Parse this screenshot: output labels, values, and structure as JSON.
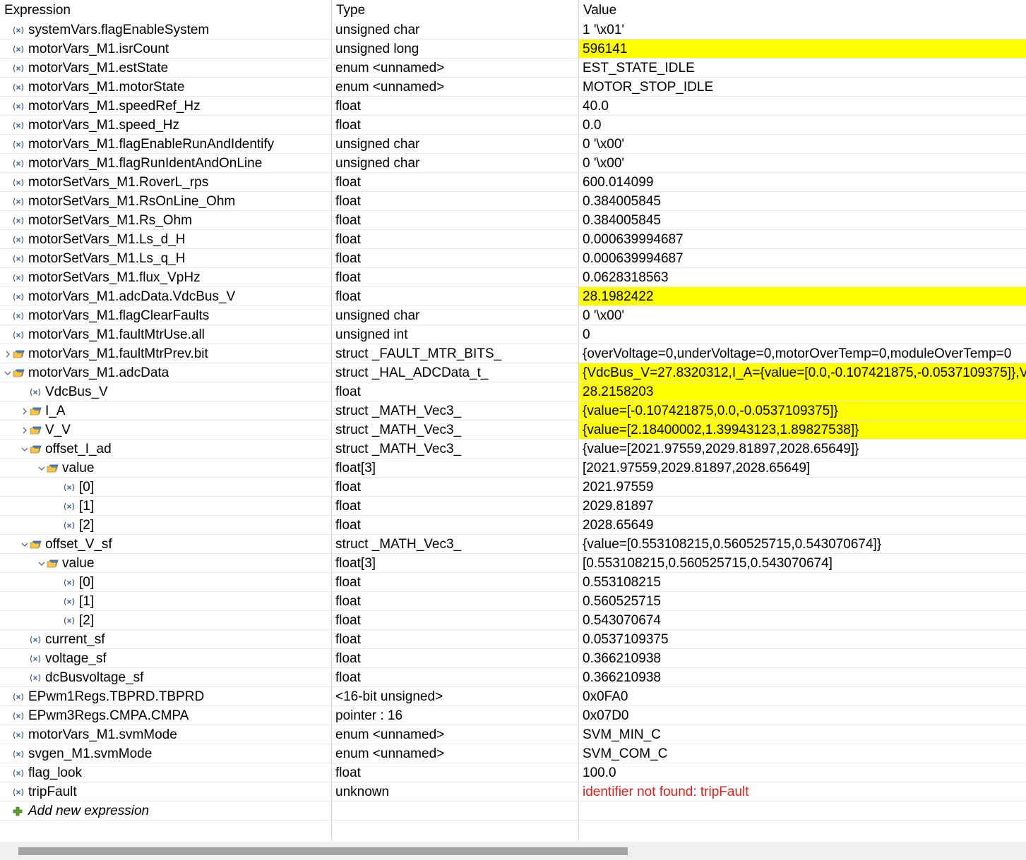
{
  "columns": {
    "expression": "Expression",
    "type": "Type",
    "value": "Value"
  },
  "rows": [
    {
      "indent": 1,
      "expander": "none",
      "icon": "variable",
      "expression": "systemVars.flagEnableSystem",
      "type": "unsigned char",
      "value": "1 '\\x01'",
      "highlight": false,
      "error": false
    },
    {
      "indent": 1,
      "expander": "none",
      "icon": "variable",
      "expression": "motorVars_M1.isrCount",
      "type": "unsigned long",
      "value": "596141",
      "highlight": true,
      "error": false
    },
    {
      "indent": 1,
      "expander": "none",
      "icon": "variable",
      "expression": "motorVars_M1.estState",
      "type": "enum <unnamed>",
      "value": "EST_STATE_IDLE",
      "highlight": false,
      "error": false
    },
    {
      "indent": 1,
      "expander": "none",
      "icon": "variable",
      "expression": "motorVars_M1.motorState",
      "type": "enum <unnamed>",
      "value": "MOTOR_STOP_IDLE",
      "highlight": false,
      "error": false
    },
    {
      "indent": 1,
      "expander": "none",
      "icon": "variable",
      "expression": "motorVars_M1.speedRef_Hz",
      "type": "float",
      "value": "40.0",
      "highlight": false,
      "error": false
    },
    {
      "indent": 1,
      "expander": "none",
      "icon": "variable",
      "expression": "motorVars_M1.speed_Hz",
      "type": "float",
      "value": "0.0",
      "highlight": false,
      "error": false
    },
    {
      "indent": 1,
      "expander": "none",
      "icon": "variable",
      "expression": "motorVars_M1.flagEnableRunAndIdentify",
      "type": "unsigned char",
      "value": "0 '\\x00'",
      "highlight": false,
      "error": false
    },
    {
      "indent": 1,
      "expander": "none",
      "icon": "variable",
      "expression": "motorVars_M1.flagRunIdentAndOnLine",
      "type": "unsigned char",
      "value": "0 '\\x00'",
      "highlight": false,
      "error": false
    },
    {
      "indent": 1,
      "expander": "none",
      "icon": "variable",
      "expression": "motorSetVars_M1.RoverL_rps",
      "type": "float",
      "value": "600.014099",
      "highlight": false,
      "error": false
    },
    {
      "indent": 1,
      "expander": "none",
      "icon": "variable",
      "expression": "motorSetVars_M1.RsOnLine_Ohm",
      "type": "float",
      "value": "0.384005845",
      "highlight": false,
      "error": false
    },
    {
      "indent": 1,
      "expander": "none",
      "icon": "variable",
      "expression": "motorSetVars_M1.Rs_Ohm",
      "type": "float",
      "value": "0.384005845",
      "highlight": false,
      "error": false
    },
    {
      "indent": 1,
      "expander": "none",
      "icon": "variable",
      "expression": "motorSetVars_M1.Ls_d_H",
      "type": "float",
      "value": "0.000639994687",
      "highlight": false,
      "error": false
    },
    {
      "indent": 1,
      "expander": "none",
      "icon": "variable",
      "expression": "motorSetVars_M1.Ls_q_H",
      "type": "float",
      "value": "0.000639994687",
      "highlight": false,
      "error": false
    },
    {
      "indent": 1,
      "expander": "none",
      "icon": "variable",
      "expression": "motorSetVars_M1.flux_VpHz",
      "type": "float",
      "value": "0.0628318563",
      "highlight": false,
      "error": false
    },
    {
      "indent": 1,
      "expander": "none",
      "icon": "variable",
      "expression": "motorVars_M1.adcData.VdcBus_V",
      "type": "float",
      "value": "28.1982422",
      "highlight": true,
      "error": false
    },
    {
      "indent": 1,
      "expander": "none",
      "icon": "variable",
      "expression": "motorVars_M1.flagClearFaults",
      "type": "unsigned char",
      "value": "0 '\\x00'",
      "highlight": false,
      "error": false
    },
    {
      "indent": 1,
      "expander": "none",
      "icon": "variable",
      "expression": "motorVars_M1.faultMtrUse.all",
      "type": "unsigned int",
      "value": "0",
      "highlight": false,
      "error": false
    },
    {
      "indent": 1,
      "expander": "collapsed",
      "icon": "struct",
      "expression": "motorVars_M1.faultMtrPrev.bit",
      "type": "struct _FAULT_MTR_BITS_",
      "value": "{overVoltage=0,underVoltage=0,motorOverTemp=0,moduleOverTemp=0",
      "highlight": false,
      "error": false
    },
    {
      "indent": 1,
      "expander": "expanded",
      "icon": "struct",
      "expression": "motorVars_M1.adcData",
      "type": "struct _HAL_ADCData_t_",
      "value": "{VdcBus_V=27.8320312,I_A={value=[0.0,-0.107421875,-0.0537109375]},V",
      "highlight": true,
      "error": false
    },
    {
      "indent": 2,
      "expander": "none",
      "icon": "variable",
      "expression": "VdcBus_V",
      "type": "float",
      "value": "28.2158203",
      "highlight": true,
      "error": false
    },
    {
      "indent": 2,
      "expander": "collapsed",
      "icon": "struct",
      "expression": "I_A",
      "type": "struct _MATH_Vec3_",
      "value": "{value=[-0.107421875,0.0,-0.0537109375]}",
      "highlight": true,
      "error": false
    },
    {
      "indent": 2,
      "expander": "collapsed",
      "icon": "struct",
      "expression": "V_V",
      "type": "struct _MATH_Vec3_",
      "value": "{value=[2.18400002,1.39943123,1.89827538]}",
      "highlight": true,
      "error": false
    },
    {
      "indent": 2,
      "expander": "expanded",
      "icon": "struct",
      "expression": "offset_I_ad",
      "type": "struct _MATH_Vec3_",
      "value": "{value=[2021.97559,2029.81897,2028.65649]}",
      "highlight": false,
      "error": false
    },
    {
      "indent": 3,
      "expander": "expanded",
      "icon": "struct",
      "expression": "value",
      "type": "float[3]",
      "value": "[2021.97559,2029.81897,2028.65649]",
      "highlight": false,
      "error": false
    },
    {
      "indent": 4,
      "expander": "none",
      "icon": "variable",
      "expression": "[0]",
      "type": "float",
      "value": "2021.97559",
      "highlight": false,
      "error": false
    },
    {
      "indent": 4,
      "expander": "none",
      "icon": "variable",
      "expression": "[1]",
      "type": "float",
      "value": "2029.81897",
      "highlight": false,
      "error": false
    },
    {
      "indent": 4,
      "expander": "none",
      "icon": "variable",
      "expression": "[2]",
      "type": "float",
      "value": "2028.65649",
      "highlight": false,
      "error": false
    },
    {
      "indent": 2,
      "expander": "expanded",
      "icon": "struct",
      "expression": "offset_V_sf",
      "type": "struct _MATH_Vec3_",
      "value": "{value=[0.553108215,0.560525715,0.543070674]}",
      "highlight": false,
      "error": false
    },
    {
      "indent": 3,
      "expander": "expanded",
      "icon": "struct",
      "expression": "value",
      "type": "float[3]",
      "value": "[0.553108215,0.560525715,0.543070674]",
      "highlight": false,
      "error": false
    },
    {
      "indent": 4,
      "expander": "none",
      "icon": "variable",
      "expression": "[0]",
      "type": "float",
      "value": "0.553108215",
      "highlight": false,
      "error": false
    },
    {
      "indent": 4,
      "expander": "none",
      "icon": "variable",
      "expression": "[1]",
      "type": "float",
      "value": "0.560525715",
      "highlight": false,
      "error": false
    },
    {
      "indent": 4,
      "expander": "none",
      "icon": "variable",
      "expression": "[2]",
      "type": "float",
      "value": "0.543070674",
      "highlight": false,
      "error": false
    },
    {
      "indent": 2,
      "expander": "none",
      "icon": "variable",
      "expression": "current_sf",
      "type": "float",
      "value": "0.0537109375",
      "highlight": false,
      "error": false
    },
    {
      "indent": 2,
      "expander": "none",
      "icon": "variable",
      "expression": "voltage_sf",
      "type": "float",
      "value": "0.366210938",
      "highlight": false,
      "error": false
    },
    {
      "indent": 2,
      "expander": "none",
      "icon": "variable",
      "expression": "dcBusvoltage_sf",
      "type": "float",
      "value": "0.366210938",
      "highlight": false,
      "error": false
    },
    {
      "indent": 1,
      "expander": "none",
      "icon": "variable",
      "expression": "EPwm1Regs.TBPRD.TBPRD",
      "type": "<16-bit unsigned>",
      "value": "0x0FA0",
      "highlight": false,
      "error": false
    },
    {
      "indent": 1,
      "expander": "none",
      "icon": "variable",
      "expression": "EPwm3Regs.CMPA.CMPA",
      "type": "pointer : 16",
      "value": "0x07D0",
      "highlight": false,
      "error": false
    },
    {
      "indent": 1,
      "expander": "none",
      "icon": "variable",
      "expression": "motorVars_M1.svmMode",
      "type": "enum <unnamed>",
      "value": "SVM_MIN_C",
      "highlight": false,
      "error": false
    },
    {
      "indent": 1,
      "expander": "none",
      "icon": "variable",
      "expression": "svgen_M1.svmMode",
      "type": "enum <unnamed>",
      "value": "SVM_COM_C",
      "highlight": false,
      "error": false
    },
    {
      "indent": 1,
      "expander": "none",
      "icon": "variable",
      "expression": "flag_look",
      "type": "float",
      "value": "100.0",
      "highlight": false,
      "error": false
    },
    {
      "indent": 1,
      "expander": "none",
      "icon": "variable",
      "expression": "tripFault",
      "type": "unknown",
      "value": "identifier not found: tripFault",
      "highlight": false,
      "error": true
    },
    {
      "indent": 1,
      "expander": "none",
      "icon": "add",
      "expression": "Add new expression",
      "type": "",
      "value": "",
      "highlight": false,
      "error": false
    }
  ],
  "colors": {
    "highlight": "#ffff00",
    "error": "#e0201c",
    "add_icon": "#5aa02c"
  }
}
